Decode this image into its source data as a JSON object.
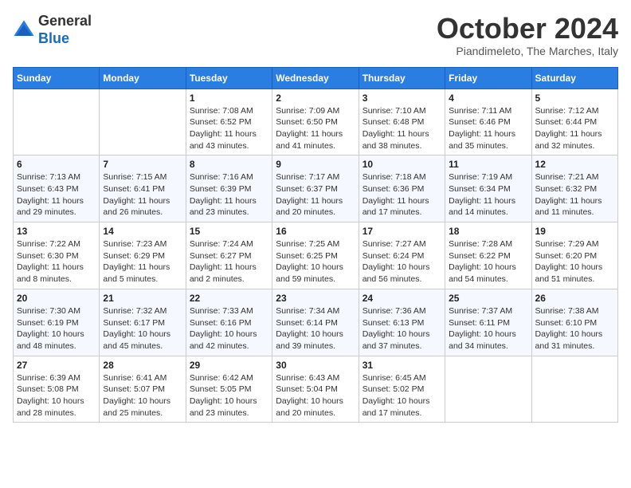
{
  "header": {
    "logo_general": "General",
    "logo_blue": "Blue",
    "month_title": "October 2024",
    "location": "Piandimeleto, The Marches, Italy"
  },
  "weekdays": [
    "Sunday",
    "Monday",
    "Tuesday",
    "Wednesday",
    "Thursday",
    "Friday",
    "Saturday"
  ],
  "weeks": [
    [
      {
        "day": "",
        "info": ""
      },
      {
        "day": "",
        "info": ""
      },
      {
        "day": "1",
        "info": "Sunrise: 7:08 AM\nSunset: 6:52 PM\nDaylight: 11 hours and 43 minutes."
      },
      {
        "day": "2",
        "info": "Sunrise: 7:09 AM\nSunset: 6:50 PM\nDaylight: 11 hours and 41 minutes."
      },
      {
        "day": "3",
        "info": "Sunrise: 7:10 AM\nSunset: 6:48 PM\nDaylight: 11 hours and 38 minutes."
      },
      {
        "day": "4",
        "info": "Sunrise: 7:11 AM\nSunset: 6:46 PM\nDaylight: 11 hours and 35 minutes."
      },
      {
        "day": "5",
        "info": "Sunrise: 7:12 AM\nSunset: 6:44 PM\nDaylight: 11 hours and 32 minutes."
      }
    ],
    [
      {
        "day": "6",
        "info": "Sunrise: 7:13 AM\nSunset: 6:43 PM\nDaylight: 11 hours and 29 minutes."
      },
      {
        "day": "7",
        "info": "Sunrise: 7:15 AM\nSunset: 6:41 PM\nDaylight: 11 hours and 26 minutes."
      },
      {
        "day": "8",
        "info": "Sunrise: 7:16 AM\nSunset: 6:39 PM\nDaylight: 11 hours and 23 minutes."
      },
      {
        "day": "9",
        "info": "Sunrise: 7:17 AM\nSunset: 6:37 PM\nDaylight: 11 hours and 20 minutes."
      },
      {
        "day": "10",
        "info": "Sunrise: 7:18 AM\nSunset: 6:36 PM\nDaylight: 11 hours and 17 minutes."
      },
      {
        "day": "11",
        "info": "Sunrise: 7:19 AM\nSunset: 6:34 PM\nDaylight: 11 hours and 14 minutes."
      },
      {
        "day": "12",
        "info": "Sunrise: 7:21 AM\nSunset: 6:32 PM\nDaylight: 11 hours and 11 minutes."
      }
    ],
    [
      {
        "day": "13",
        "info": "Sunrise: 7:22 AM\nSunset: 6:30 PM\nDaylight: 11 hours and 8 minutes."
      },
      {
        "day": "14",
        "info": "Sunrise: 7:23 AM\nSunset: 6:29 PM\nDaylight: 11 hours and 5 minutes."
      },
      {
        "day": "15",
        "info": "Sunrise: 7:24 AM\nSunset: 6:27 PM\nDaylight: 11 hours and 2 minutes."
      },
      {
        "day": "16",
        "info": "Sunrise: 7:25 AM\nSunset: 6:25 PM\nDaylight: 10 hours and 59 minutes."
      },
      {
        "day": "17",
        "info": "Sunrise: 7:27 AM\nSunset: 6:24 PM\nDaylight: 10 hours and 56 minutes."
      },
      {
        "day": "18",
        "info": "Sunrise: 7:28 AM\nSunset: 6:22 PM\nDaylight: 10 hours and 54 minutes."
      },
      {
        "day": "19",
        "info": "Sunrise: 7:29 AM\nSunset: 6:20 PM\nDaylight: 10 hours and 51 minutes."
      }
    ],
    [
      {
        "day": "20",
        "info": "Sunrise: 7:30 AM\nSunset: 6:19 PM\nDaylight: 10 hours and 48 minutes."
      },
      {
        "day": "21",
        "info": "Sunrise: 7:32 AM\nSunset: 6:17 PM\nDaylight: 10 hours and 45 minutes."
      },
      {
        "day": "22",
        "info": "Sunrise: 7:33 AM\nSunset: 6:16 PM\nDaylight: 10 hours and 42 minutes."
      },
      {
        "day": "23",
        "info": "Sunrise: 7:34 AM\nSunset: 6:14 PM\nDaylight: 10 hours and 39 minutes."
      },
      {
        "day": "24",
        "info": "Sunrise: 7:36 AM\nSunset: 6:13 PM\nDaylight: 10 hours and 37 minutes."
      },
      {
        "day": "25",
        "info": "Sunrise: 7:37 AM\nSunset: 6:11 PM\nDaylight: 10 hours and 34 minutes."
      },
      {
        "day": "26",
        "info": "Sunrise: 7:38 AM\nSunset: 6:10 PM\nDaylight: 10 hours and 31 minutes."
      }
    ],
    [
      {
        "day": "27",
        "info": "Sunrise: 6:39 AM\nSunset: 5:08 PM\nDaylight: 10 hours and 28 minutes."
      },
      {
        "day": "28",
        "info": "Sunrise: 6:41 AM\nSunset: 5:07 PM\nDaylight: 10 hours and 25 minutes."
      },
      {
        "day": "29",
        "info": "Sunrise: 6:42 AM\nSunset: 5:05 PM\nDaylight: 10 hours and 23 minutes."
      },
      {
        "day": "30",
        "info": "Sunrise: 6:43 AM\nSunset: 5:04 PM\nDaylight: 10 hours and 20 minutes."
      },
      {
        "day": "31",
        "info": "Sunrise: 6:45 AM\nSunset: 5:02 PM\nDaylight: 10 hours and 17 minutes."
      },
      {
        "day": "",
        "info": ""
      },
      {
        "day": "",
        "info": ""
      }
    ]
  ]
}
